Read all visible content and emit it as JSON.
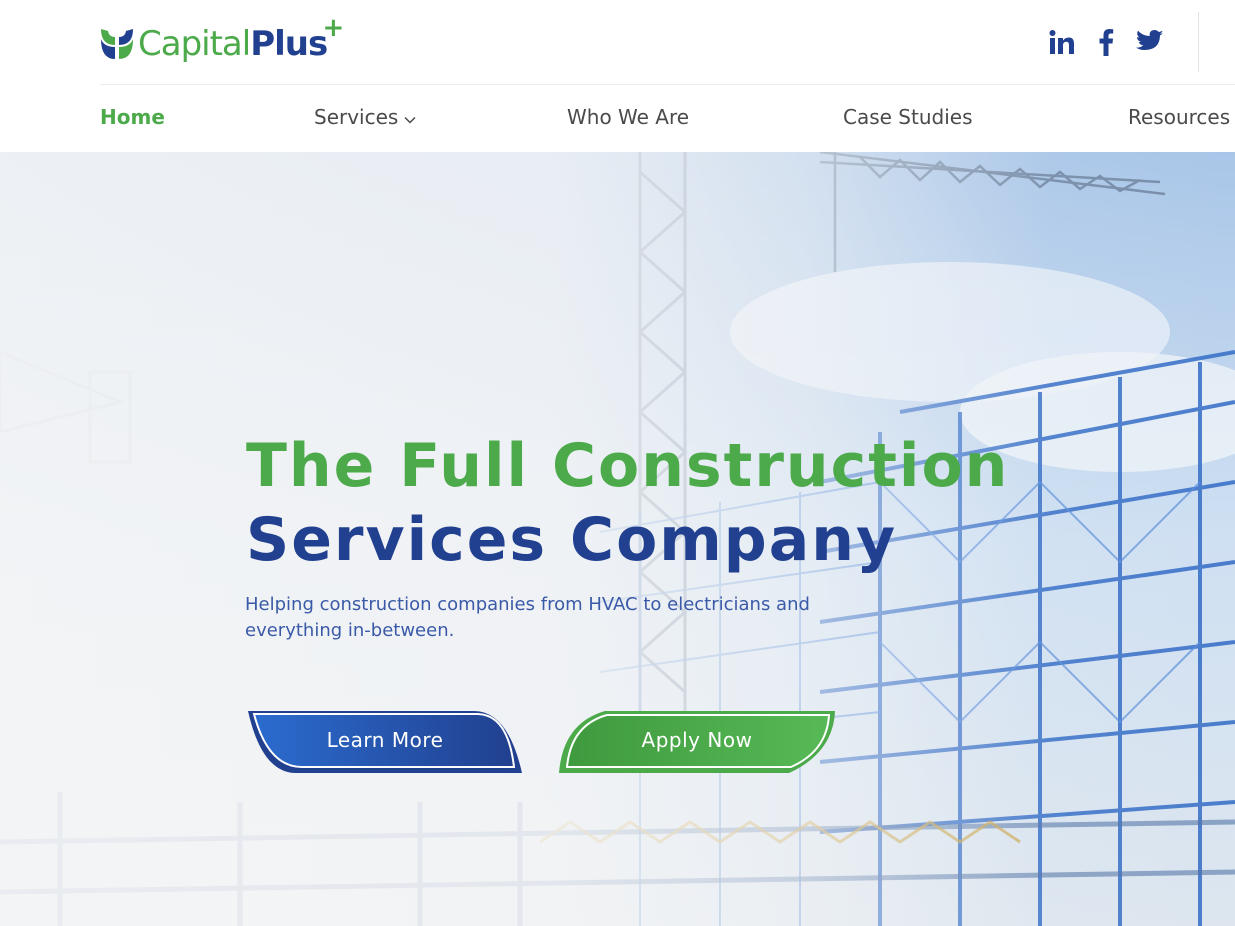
{
  "brand": {
    "name_part1": "Capital",
    "name_part2": "Plus",
    "plus_sign": "+",
    "colors": {
      "green": "#4caa4b",
      "navy": "#21408f"
    }
  },
  "social": [
    {
      "name": "LinkedIn",
      "icon": "linkedin-icon"
    },
    {
      "name": "Facebook",
      "icon": "facebook-icon"
    },
    {
      "name": "Twitter",
      "icon": "twitter-icon"
    }
  ],
  "nav": {
    "items": [
      {
        "label": "Home",
        "active": true
      },
      {
        "label": "Services",
        "has_dropdown": true
      },
      {
        "label": "Who We Are"
      },
      {
        "label": "Case Studies"
      },
      {
        "label": "Resources"
      }
    ]
  },
  "hero": {
    "title_line1": "The Full Construction",
    "title_line2": "Services Company",
    "subtitle": "Helping construction companies from HVAC to electricians and everything in-between.",
    "primary_button": "Learn More",
    "secondary_button": "Apply Now"
  }
}
